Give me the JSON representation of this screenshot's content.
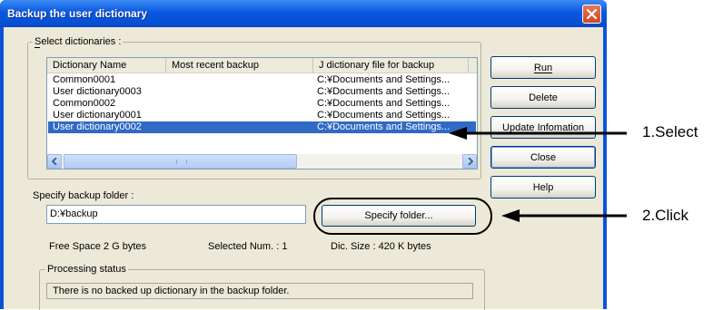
{
  "window": {
    "title": "Backup the user dictionary",
    "close_icon": "close-icon",
    "colors": {
      "titlebar": "#0a57e0",
      "face": "#ece9d8",
      "selection": "#316ac5"
    }
  },
  "dictionaries": {
    "label": "Select dictionaries :",
    "columns": [
      "Dictionary Name",
      "Most recent backup",
      "J dictionary file for backup"
    ],
    "rows": [
      {
        "name": "Common0001",
        "recent": "",
        "file": "C:¥Documents and Settings..."
      },
      {
        "name": "User dictionary0003",
        "recent": "",
        "file": "C:¥Documents and Settings..."
      },
      {
        "name": "Common0002",
        "recent": "",
        "file": "C:¥Documents and Settings..."
      },
      {
        "name": "User dictionary0001",
        "recent": "",
        "file": "C:¥Documents and Settings..."
      },
      {
        "name": "User dictionary0002",
        "recent": "",
        "file": "C:¥Documents and Settings...",
        "selected": true
      }
    ]
  },
  "buttons": {
    "run": "Run",
    "delete": "Delete",
    "update": "Update Infomation",
    "close": "Close",
    "help": "Help",
    "specify_folder": "Specify folder..."
  },
  "backup_folder": {
    "label": "Specify backup folder :",
    "value": "D:¥backup"
  },
  "info": {
    "free_space": "Free Space  2 G bytes",
    "selected_num": "Selected Num. : 1",
    "dic_size": "Dic. Size :  420 K bytes"
  },
  "processing": {
    "label": "Processing status",
    "message": "There is no backed up dictionary in the backup folder."
  },
  "callouts": {
    "select": "1.Select",
    "click": "2.Click"
  }
}
